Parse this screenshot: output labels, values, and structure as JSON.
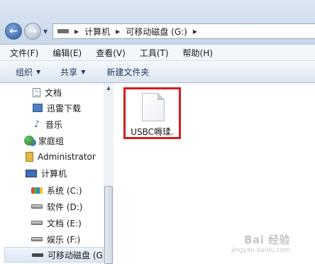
{
  "address_bar": {
    "breadcrumbs": [
      "计算机",
      "可移动磁盘 (G:)"
    ]
  },
  "menu": [
    "文件(F)",
    "编辑(E)",
    "查看(V)",
    "工具(T)",
    "帮助(H)"
  ],
  "toolbar": {
    "organize": "组织",
    "share": "共享",
    "new_folder": "新建文件夹"
  },
  "nav": [
    {
      "label": "文档",
      "icon": "document-icon"
    },
    {
      "label": "迅雷下载",
      "icon": "download-folder-icon"
    },
    {
      "label": "音乐",
      "icon": "music-icon"
    },
    {
      "label": "家庭组",
      "icon": "homegroup-icon"
    },
    {
      "label": "Administrator",
      "icon": "user-folder-icon"
    },
    {
      "label": "计算机",
      "icon": "computer-icon"
    },
    {
      "label": "系统 (C:)",
      "icon": "system-drive-icon"
    },
    {
      "label": "软件 (D:)",
      "icon": "drive-icon"
    },
    {
      "label": "文档 (E:)",
      "icon": "drive-icon"
    },
    {
      "label": "娱乐 (F:)",
      "icon": "drive-icon"
    },
    {
      "label": "可移动磁盘 (G:",
      "icon": "usb-drive-icon"
    }
  ],
  "files": [
    {
      "name": "USBC嗕瑈.",
      "icon": "file-icon",
      "highlighted": true
    }
  ],
  "watermark": {
    "logo": "Bai 经验",
    "url": "jingyan.baidu.com"
  },
  "colors": {
    "highlight_border": "#d31d1d",
    "toolbar_text": "#1e395b"
  }
}
